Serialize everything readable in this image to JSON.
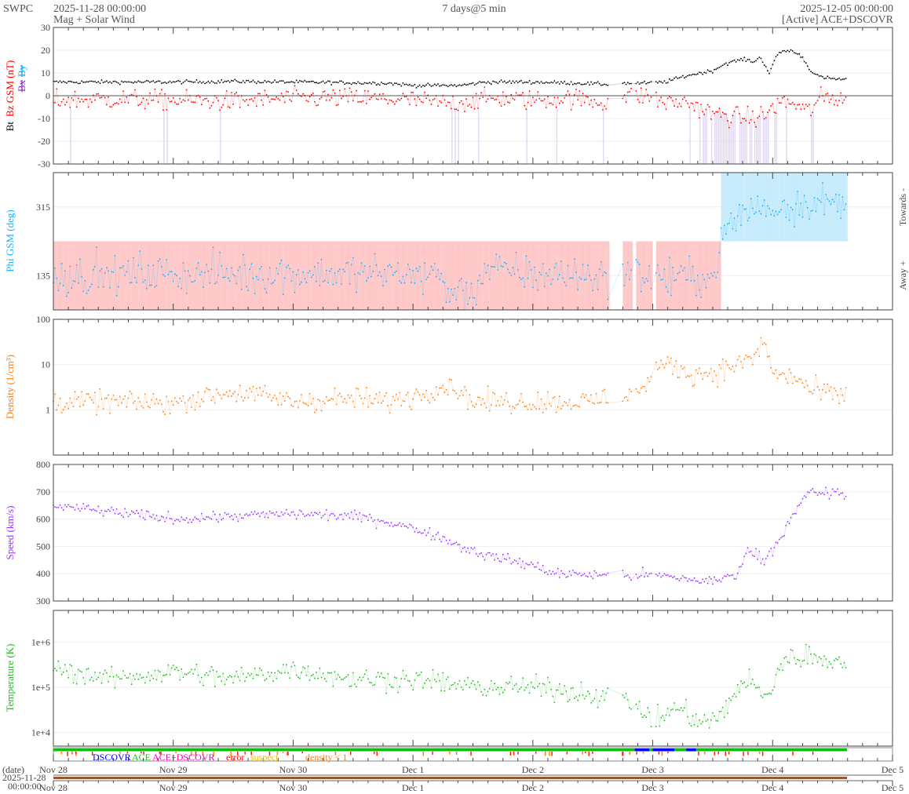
{
  "header": {
    "org": "SWPC",
    "start": "2025-11-28 00:00:00",
    "product": "Mag + Solar Wind",
    "span": "7 days@5 min",
    "end": "2025-12-05 00:00:00",
    "source": "[Active] ACE+DSCOVR"
  },
  "colors": {
    "bt": "#000000",
    "bz": "#ff0000",
    "bx": "#8a2be2",
    "by": "#00aaff",
    "phi": "#1ab2ff",
    "density": "#ff7f0e",
    "speed": "#9933ff",
    "temp": "#22bb22"
  },
  "chart_data": [
    {
      "type": "scatter",
      "name": "mag",
      "ylabel_parts": [
        "Bt",
        "Bz GSM (nT)",
        "Bx",
        "By"
      ],
      "ylim": [
        -30,
        30
      ],
      "yticks": [
        "30",
        "20",
        "10",
        "0",
        "-10",
        "-20",
        "-30"
      ],
      "series": [
        {
          "name": "Bt",
          "anchors": [
            [
              0,
              6
            ],
            [
              1,
              6
            ],
            [
              1.5,
              6.3
            ],
            [
              2,
              6
            ],
            [
              2.8,
              5.5
            ],
            [
              3.0,
              4.5
            ],
            [
              3.4,
              4.5
            ],
            [
              3.6,
              6
            ],
            [
              4.0,
              6
            ],
            [
              4.4,
              5.5
            ],
            [
              4.6,
              5
            ],
            [
              4.75,
              5.5
            ],
            [
              4.95,
              5.5
            ],
            [
              5.1,
              6
            ],
            [
              5.3,
              9
            ],
            [
              5.5,
              11
            ],
            [
              5.6,
              14
            ],
            [
              5.75,
              16
            ],
            [
              5.85,
              15
            ],
            [
              5.9,
              17
            ],
            [
              5.97,
              10
            ],
            [
              6.05,
              19
            ],
            [
              6.15,
              20
            ],
            [
              6.25,
              17
            ],
            [
              6.3,
              12
            ],
            [
              6.4,
              8
            ],
            [
              6.6,
              7
            ]
          ]
        },
        {
          "name": "Bz",
          "anchors": [
            [
              0,
              -2
            ],
            [
              0.5,
              -1.5
            ],
            [
              1,
              -2
            ],
            [
              1.5,
              -2.5
            ],
            [
              2,
              -1
            ],
            [
              2.5,
              -1
            ],
            [
              3,
              -2
            ],
            [
              3.3,
              -3.5
            ],
            [
              3.7,
              -1
            ],
            [
              4.0,
              -2
            ],
            [
              4.3,
              -1
            ],
            [
              4.6,
              -3
            ],
            [
              4.75,
              0
            ],
            [
              4.95,
              0
            ],
            [
              5.1,
              -3
            ],
            [
              5.3,
              -3
            ],
            [
              5.5,
              -8
            ],
            [
              5.65,
              -9
            ],
            [
              5.85,
              -10
            ],
            [
              5.95,
              -8
            ],
            [
              6.05,
              -3
            ],
            [
              6.15,
              -3
            ],
            [
              6.3,
              -7
            ],
            [
              6.4,
              -1
            ],
            [
              6.6,
              -1
            ]
          ]
        }
      ]
    },
    {
      "type": "scatter",
      "name": "phi",
      "ylabel": "Phi GSM (deg)",
      "ylim": [
        45,
        405
      ],
      "yticks": [
        "315",
        "135"
      ],
      "right_labels": [
        "Towards -",
        "Away +"
      ],
      "series": [
        {
          "name": "Phi",
          "anchors": [
            [
              0,
              135
            ],
            [
              1,
              140
            ],
            [
              2,
              140
            ],
            [
              3.2,
              140
            ],
            [
              3.3,
              90
            ],
            [
              3.5,
              90
            ],
            [
              3.6,
              150
            ],
            [
              4,
              140
            ],
            [
              4.6,
              135
            ],
            [
              4.75,
              140
            ],
            [
              4.95,
              140
            ],
            [
              5.0,
              130
            ],
            [
              5.5,
              130
            ],
            [
              5.6,
              250
            ],
            [
              5.75,
              300
            ],
            [
              5.85,
              310
            ],
            [
              6.1,
              315
            ],
            [
              6.3,
              330
            ],
            [
              6.6,
              320
            ]
          ]
        }
      ]
    },
    {
      "type": "scatter",
      "name": "density",
      "ylabel": "Density (1/cm³)",
      "scale": "log",
      "ylim": [
        0.1,
        100
      ],
      "yticks": [
        "100",
        "10",
        "1"
      ],
      "series": [
        {
          "name": "Density",
          "anchors": [
            [
              0,
              1.5
            ],
            [
              0.5,
              1.5
            ],
            [
              1,
              1.4
            ],
            [
              1.5,
              2.5
            ],
            [
              2,
              1.5
            ],
            [
              2.5,
              1.8
            ],
            [
              2.8,
              1.5
            ],
            [
              3.0,
              2
            ],
            [
              3.3,
              3.5
            ],
            [
              3.5,
              1.5
            ],
            [
              4.0,
              1.5
            ],
            [
              4.5,
              1.5
            ],
            [
              4.7,
              2
            ],
            [
              4.95,
              3
            ],
            [
              5.0,
              8
            ],
            [
              5.15,
              10
            ],
            [
              5.3,
              6
            ],
            [
              5.55,
              7
            ],
            [
              5.7,
              10
            ],
            [
              5.85,
              14
            ],
            [
              5.92,
              30
            ],
            [
              6.0,
              6
            ],
            [
              6.2,
              5
            ],
            [
              6.3,
              2.7
            ],
            [
              6.6,
              2
            ]
          ]
        }
      ]
    },
    {
      "type": "scatter",
      "name": "speed",
      "ylabel": "Speed (km/s)",
      "ylim": [
        300,
        800
      ],
      "yticks": [
        "800",
        "700",
        "600",
        "500",
        "400",
        "300"
      ],
      "series": [
        {
          "name": "Speed",
          "anchors": [
            [
              0,
              650
            ],
            [
              0.5,
              625
            ],
            [
              1,
              600
            ],
            [
              1.5,
              610
            ],
            [
              2,
              620
            ],
            [
              2.5,
              610
            ],
            [
              2.8,
              590
            ],
            [
              3.0,
              565
            ],
            [
              3.2,
              540
            ],
            [
              3.4,
              500
            ],
            [
              3.6,
              470
            ],
            [
              4.0,
              430
            ],
            [
              4.2,
              400
            ],
            [
              4.6,
              395
            ],
            [
              5.0,
              395
            ],
            [
              5.3,
              380
            ],
            [
              5.5,
              370
            ],
            [
              5.7,
              400
            ],
            [
              5.8,
              490
            ],
            [
              5.92,
              450
            ],
            [
              6.0,
              490
            ],
            [
              6.2,
              630
            ],
            [
              6.3,
              700
            ],
            [
              6.6,
              690
            ]
          ]
        }
      ]
    },
    {
      "type": "scatter",
      "name": "temperature",
      "ylabel": "Temperature (K)",
      "scale": "log",
      "ylim": [
        5000,
        5000000
      ],
      "yticks": [
        "1e+6",
        "1e+5",
        "1e+4"
      ],
      "series": [
        {
          "name": "Temperature",
          "anchors": [
            [
              0,
              250000
            ],
            [
              0.5,
              150000
            ],
            [
              1,
              220000
            ],
            [
              1.5,
              150000
            ],
            [
              2,
              250000
            ],
            [
              2.5,
              150000
            ],
            [
              3,
              150000
            ],
            [
              3.5,
              100000
            ],
            [
              4,
              100000
            ],
            [
              4.5,
              70000
            ],
            [
              4.8,
              50000
            ],
            [
              5.0,
              15000
            ],
            [
              5.2,
              35000
            ],
            [
              5.4,
              15000
            ],
            [
              5.6,
              25000
            ],
            [
              5.8,
              150000
            ],
            [
              5.92,
              50000
            ],
            [
              6.0,
              100000
            ],
            [
              6.1,
              400000
            ],
            [
              6.3,
              500000
            ],
            [
              6.6,
              350000
            ]
          ]
        }
      ]
    }
  ],
  "xaxis": {
    "labels": [
      "Nov 28",
      "Nov 29",
      "Nov 30",
      "Dec 1",
      "Dec 2",
      "Dec 3",
      "Dec 4",
      "Dec 5"
    ],
    "days": 7
  },
  "legend": {
    "dscovr": "DSCOVR",
    "ace": "ACE",
    "both": "ACE+DSCOVR",
    "error": "error",
    "suspect": "suspect",
    "density": "density < 1"
  },
  "date_strip": {
    "label": "(date)",
    "date": "2025-11-28",
    "time": "00:00:00"
  }
}
